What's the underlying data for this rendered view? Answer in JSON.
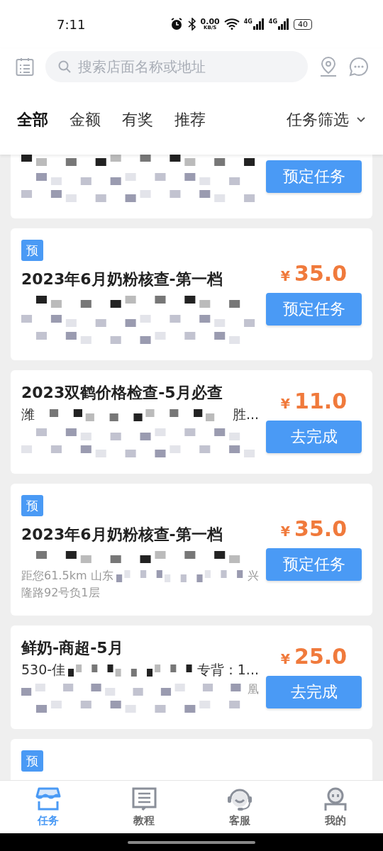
{
  "status_bar": {
    "time": "7:11",
    "speed": "0.00",
    "speed_unit": "KB/S",
    "network_1": "4G",
    "network_2": "4G",
    "battery": "40"
  },
  "header": {
    "search": {
      "placeholder": "搜索店面名称或地址"
    }
  },
  "tabs": [
    {
      "label": "全部",
      "selected": true
    },
    {
      "label": "金额",
      "selected": false
    },
    {
      "label": "有奖",
      "selected": false
    },
    {
      "label": "推荐",
      "selected": false
    }
  ],
  "filter": {
    "label": "任务筛选"
  },
  "cards": [
    {
      "button": "预定任务",
      "lines": [
        {
          "kind": "subtitle",
          "segments": [
            {
              "kind": "mosaic"
            }
          ]
        },
        {
          "kind": "address",
          "segments": [
            {
              "kind": "mosaic"
            }
          ]
        },
        {
          "kind": "address",
          "segments": [
            {
              "kind": "mosaic"
            }
          ]
        }
      ]
    },
    {
      "tag": "预",
      "title": "2023年6月奶粉核查-第一档",
      "price": {
        "symbol": "¥",
        "amount": "35.0"
      },
      "button": "预定任务",
      "lines": [
        {
          "kind": "subtitle",
          "segments": [
            {
              "kind": "mosaic"
            }
          ]
        },
        {
          "kind": "address",
          "segments": [
            {
              "kind": "mosaic"
            }
          ]
        },
        {
          "kind": "address",
          "segments": [
            {
              "kind": "mosaic"
            }
          ]
        }
      ]
    },
    {
      "title": "2023双鹤价格检查-5月必查",
      "price": {
        "symbol": "¥",
        "amount": "11.0"
      },
      "button": "去完成",
      "lines": [
        {
          "kind": "subtitle",
          "segments": [
            {
              "kind": "text",
              "text": "潍"
            },
            {
              "kind": "mosaic"
            },
            {
              "kind": "text",
              "text": "胜..."
            }
          ]
        },
        {
          "kind": "address",
          "segments": [
            {
              "kind": "mosaic"
            }
          ]
        },
        {
          "kind": "address",
          "segments": [
            {
              "kind": "mosaic"
            }
          ]
        }
      ]
    },
    {
      "tag": "预",
      "title": "2023年6月奶粉核查-第一档",
      "price": {
        "symbol": "¥",
        "amount": "35.0"
      },
      "button": "预定任务",
      "lines": [
        {
          "kind": "subtitle",
          "segments": [
            {
              "kind": "mosaic"
            }
          ]
        },
        {
          "kind": "address",
          "segments": [
            {
              "kind": "text",
              "text": "距您61.5km 山东"
            },
            {
              "kind": "mosaic"
            },
            {
              "kind": "text",
              "text": "兴"
            }
          ]
        },
        {
          "kind": "address",
          "segments": [
            {
              "kind": "text",
              "text": "隆路92号负1层"
            }
          ]
        }
      ]
    },
    {
      "title": "鲜奶-商超-5月",
      "price": {
        "symbol": "¥",
        "amount": "25.0"
      },
      "button": "去完成",
      "lines": [
        {
          "kind": "subtitle",
          "segments": [
            {
              "kind": "text",
              "text": "530-佳"
            },
            {
              "kind": "mosaic"
            },
            {
              "kind": "text",
              "text": "专背：1..."
            }
          ]
        },
        {
          "kind": "address",
          "segments": [
            {
              "kind": "mosaic"
            },
            {
              "kind": "text",
              "text": "凰"
            }
          ]
        },
        {
          "kind": "address",
          "segments": [
            {
              "kind": "mosaic"
            }
          ]
        }
      ]
    },
    {
      "tag": "预"
    }
  ],
  "bottom_nav": [
    {
      "label": "任务",
      "selected": true
    },
    {
      "label": "教程",
      "selected": false
    },
    {
      "label": "客服",
      "selected": false
    },
    {
      "label": "我的",
      "selected": false
    }
  ]
}
